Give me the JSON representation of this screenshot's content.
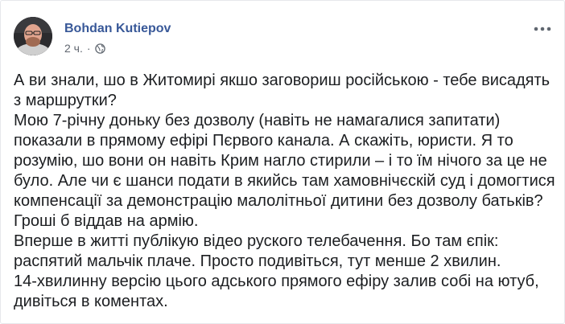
{
  "post": {
    "author": "Bohdan Kutiepov",
    "timestamp": "2 ч.",
    "separator": "·",
    "privacy_icon": "globe-icon",
    "more_icon": "more-options-icon",
    "paragraphs": [
      "А ви знали, шо в Житомирі якшо заговориш російською - тебе висадять з маршрутки?",
      "Мою 7-річну доньку без дозволу (навіть не намагалися запитати) показали в прямому ефірі Пєрвого канала. А скажіть, юристи. Я то розумію, шо вони он навіть Крим нагло стирили – і то їм нічого за це не було. Але чи є шанси подати в якийсь там хамовнічєскій суд і домогтися компенсації за демонстрацію малолітньої дитини без дозволу батьків? Гроші б віддав на армію.",
      "Вперше в житті публікую відео руского телебачення. Бо там єпік: распятий мальчік плаче. Просто подивіться, тут менше 2 хвилин.",
      "14-хвилинну версію цього адського прямого ефіру залив собі на ютуб, дивіться в коментах."
    ]
  },
  "colors": {
    "author_link": "#385898",
    "meta_text": "#616770",
    "body_text": "#1c1e21",
    "border": "#e6e8ec"
  }
}
